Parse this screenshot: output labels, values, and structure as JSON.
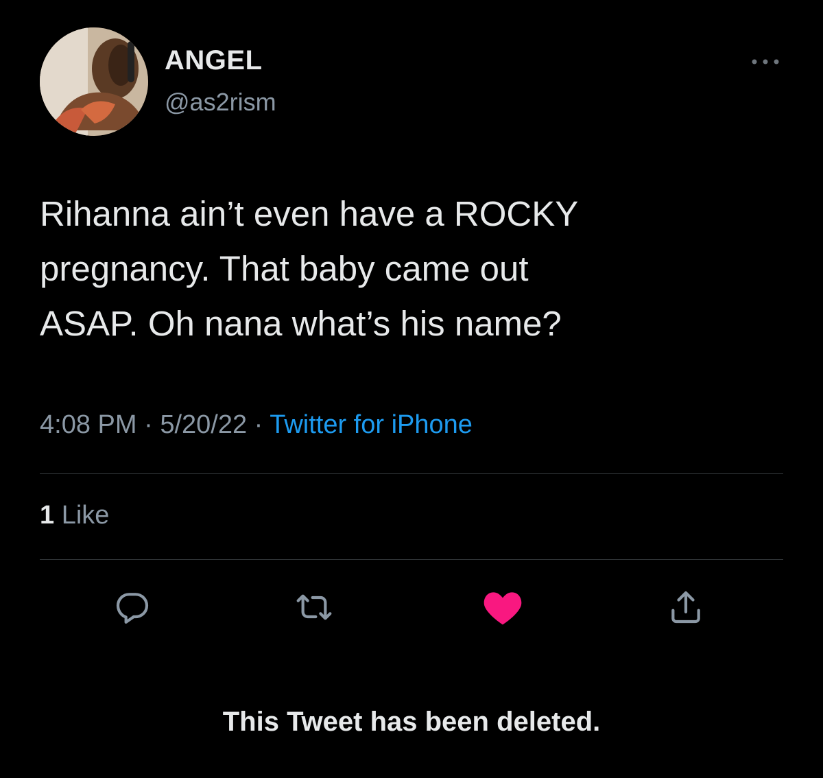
{
  "tweet": {
    "author": {
      "display_name": "ANGEL",
      "handle": "@as2rism",
      "avatar_icon": "user-avatar-photo"
    },
    "text": "Rihanna ain’t even have a ROCKY\npregnancy. That baby came out\nASAP. Oh nana what’s his name?",
    "time": "4:08 PM",
    "date": "5/20/22",
    "separator": "·",
    "source": "Twitter for iPhone",
    "likes": {
      "count": "1",
      "label": "Like"
    },
    "actions": {
      "reply_icon": "reply-icon",
      "retweet_icon": "retweet-icon",
      "like_icon": "heart-icon",
      "share_icon": "share-icon",
      "more_icon": "more-options-icon"
    },
    "status_note": "This Tweet has been deleted."
  },
  "colors": {
    "background": "#000000",
    "text_primary": "#e7e9ea",
    "text_secondary": "#8b98a5",
    "link": "#1d9bf0",
    "like_active": "#f91880",
    "divider": "#2f3336"
  }
}
